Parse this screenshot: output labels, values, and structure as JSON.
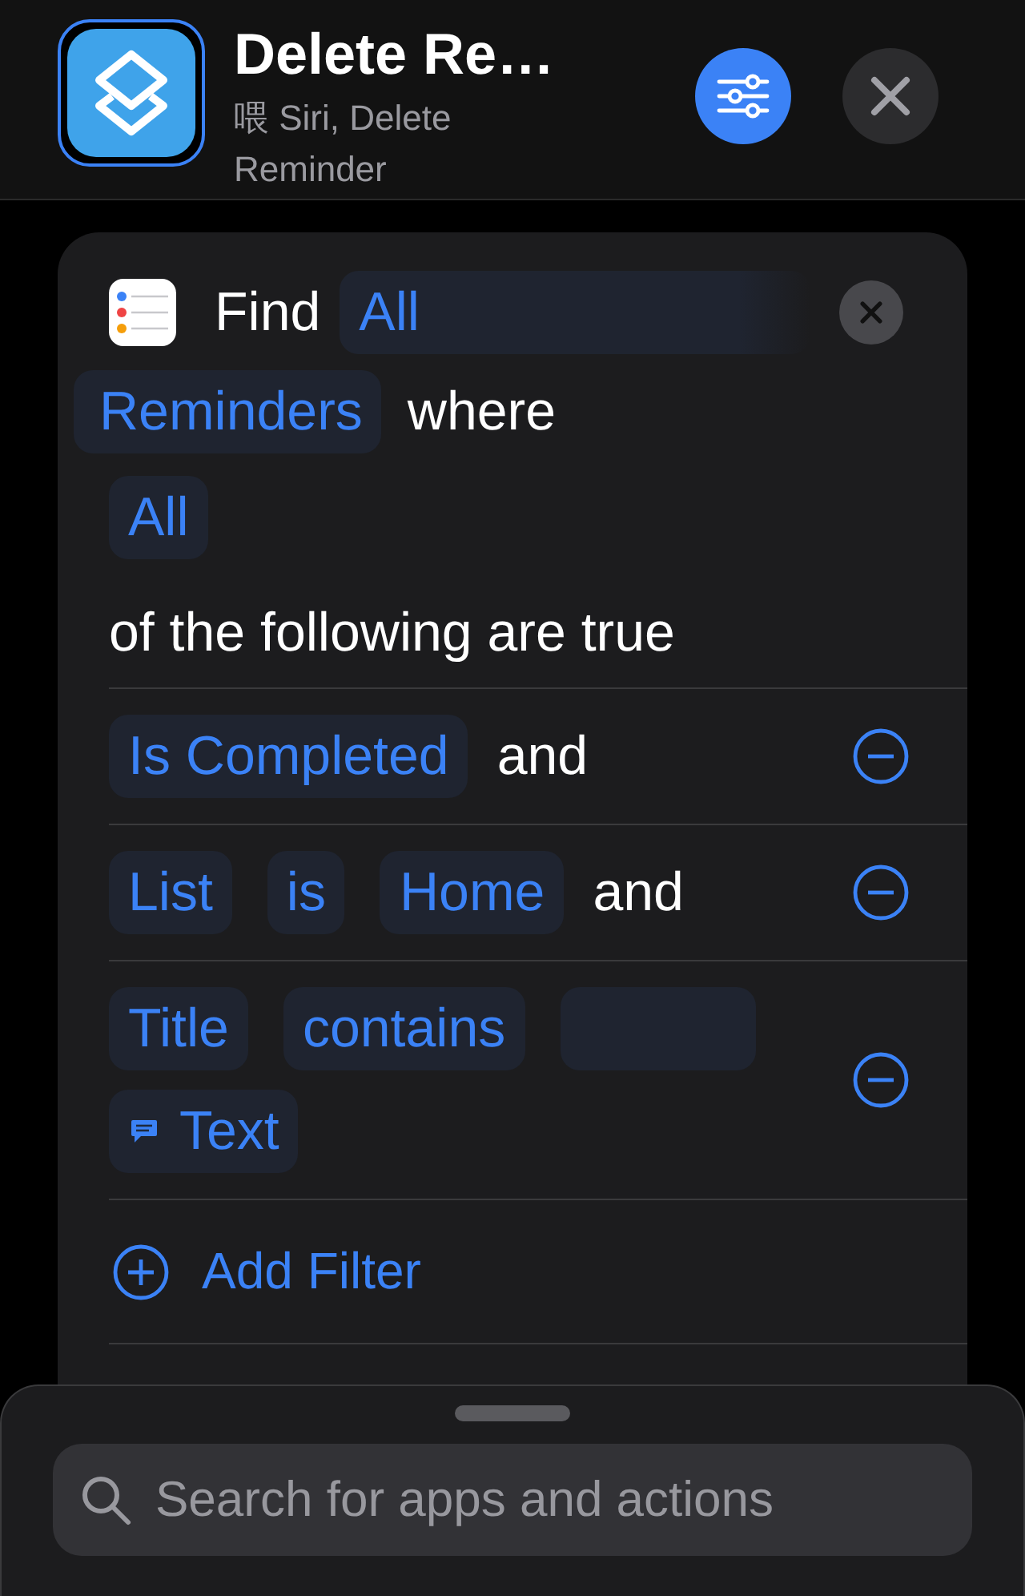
{
  "header": {
    "title": "Delete Re…",
    "subtitle": "喂 Siri, Delete Reminder"
  },
  "action": {
    "verb": "Find",
    "quantity": "All",
    "entity": "Reminders",
    "connector": "where",
    "match": "All",
    "match_text": "of the following are true"
  },
  "filters": [
    {
      "parts": [
        {
          "kind": "token",
          "text": "Is Completed"
        },
        {
          "kind": "word",
          "text": "and"
        }
      ]
    },
    {
      "parts": [
        {
          "kind": "token",
          "text": "List"
        },
        {
          "kind": "token",
          "text": "is"
        },
        {
          "kind": "token",
          "text": "Home"
        },
        {
          "kind": "word",
          "text": "and"
        }
      ]
    },
    {
      "parts": [
        {
          "kind": "token",
          "text": "Title"
        },
        {
          "kind": "token",
          "text": "contains"
        },
        {
          "kind": "blank"
        },
        {
          "kind": "variable",
          "text": "Text"
        }
      ]
    }
  ],
  "add_filter": "Add Filter",
  "search": {
    "placeholder": "Search for apps and actions"
  }
}
